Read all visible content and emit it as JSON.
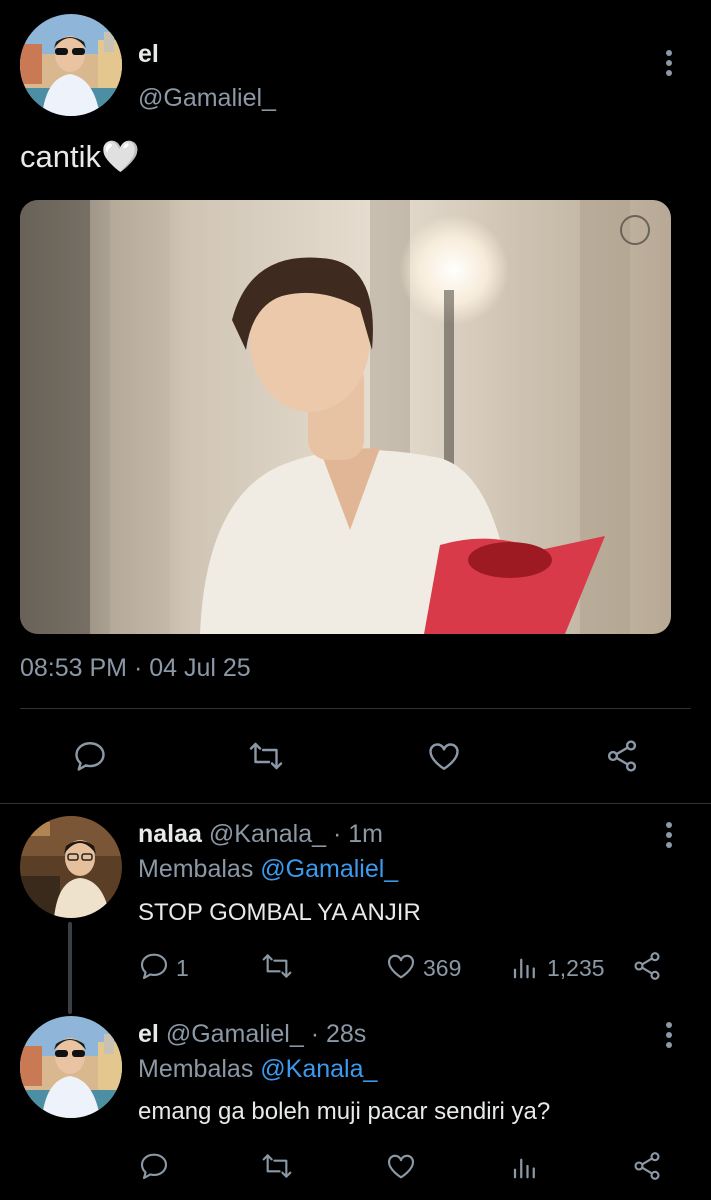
{
  "colors": {
    "background": "#000000",
    "text": "#e7e9ea",
    "muted": "#8b98a5",
    "link": "#3b9aee",
    "divider": "#2f3336"
  },
  "main_tweet": {
    "name": "el",
    "handle": "@Gamaliel_",
    "text": "cantik🤍",
    "timestamp": "08:53 PM · 04 Jul 25",
    "menu_icon": "more-vertical-icon",
    "actions": [
      "reply-icon",
      "retweet-icon",
      "like-icon",
      "share-icon"
    ]
  },
  "replies": [
    {
      "name": "nalaa",
      "handle": "@Kanala_",
      "time": "· 1m",
      "replying_prefix": "Membalas",
      "replying_to": "@Gamaliel_",
      "text": "STOP GOMBAL YA ANJIR",
      "reply_count": "1",
      "like_count": "369",
      "view_count": "1,235"
    },
    {
      "name": "el",
      "handle": "@Gamaliel_",
      "time": "· 28s",
      "replying_prefix": "Membalas",
      "replying_to": "@Kanala_",
      "text": "emang ga boleh muji pacar sendiri ya?"
    }
  ]
}
